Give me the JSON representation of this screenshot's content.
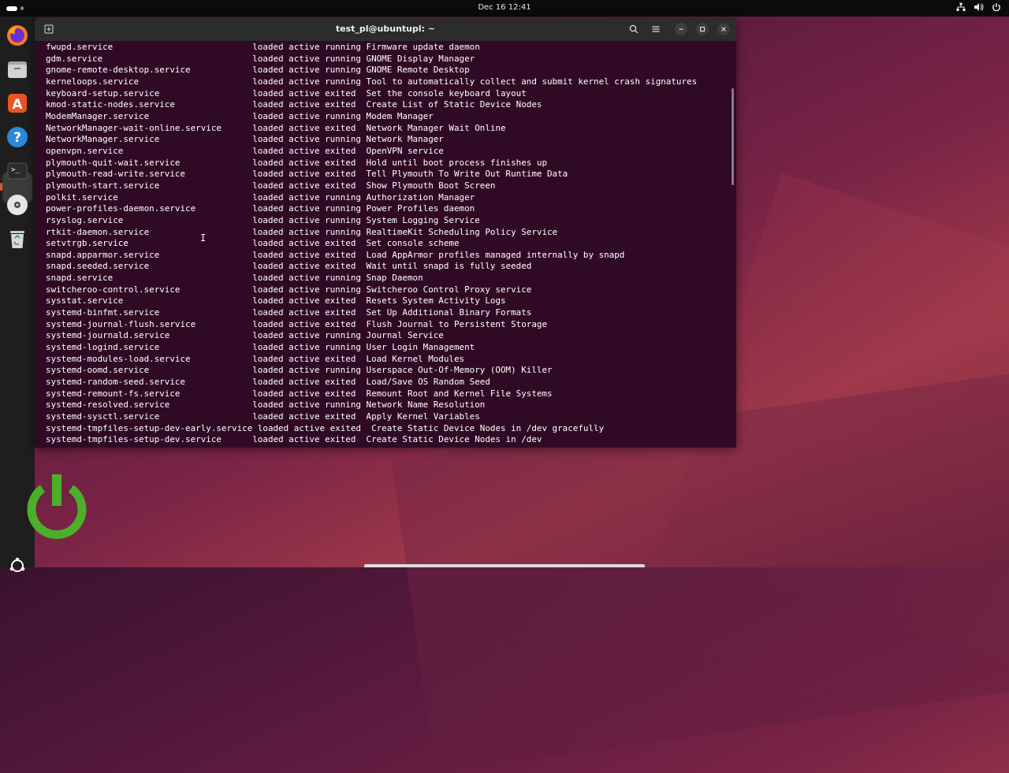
{
  "topbar": {
    "clock": "Dec 16  12:41",
    "tray_icons": [
      "network-icon",
      "volume-icon",
      "power-icon"
    ]
  },
  "dock": {
    "items": [
      "Firefox",
      "Files",
      "App Center",
      "Help",
      "Terminal",
      "Disc",
      "Trash"
    ],
    "active": "Terminal",
    "accent": "#e95420"
  },
  "terminal": {
    "title": "test_pl@ubuntupl: ~",
    "background": "#300a24",
    "lines": [
      "fwupd.service                           loaded active running Firmware update daemon",
      "gdm.service                             loaded active running GNOME Display Manager",
      "gnome-remote-desktop.service            loaded active running GNOME Remote Desktop",
      "kerneloops.service                      loaded active running Tool to automatically collect and submit kernel crash signatures",
      "keyboard-setup.service                  loaded active exited  Set the console keyboard layout",
      "kmod-static-nodes.service               loaded active exited  Create List of Static Device Nodes",
      "ModemManager.service                    loaded active running Modem Manager",
      "NetworkManager-wait-online.service      loaded active exited  Network Manager Wait Online",
      "NetworkManager.service                  loaded active running Network Manager",
      "openvpn.service                         loaded active exited  OpenVPN service",
      "plymouth-quit-wait.service              loaded active exited  Hold until boot process finishes up",
      "plymouth-read-write.service             loaded active exited  Tell Plymouth To Write Out Runtime Data",
      "plymouth-start.service                  loaded active exited  Show Plymouth Boot Screen",
      "polkit.service                          loaded active running Authorization Manager",
      "power-profiles-daemon.service           loaded active running Power Profiles daemon",
      "rsyslog.service                         loaded active running System Logging Service",
      "rtkit-daemon.service                    loaded active running RealtimeKit Scheduling Policy Service",
      "setvtrgb.service                        loaded active exited  Set console scheme",
      "snapd.apparmor.service                  loaded active exited  Load AppArmor profiles managed internally by snapd",
      "snapd.seeded.service                    loaded active exited  Wait until snapd is fully seeded",
      "snapd.service                           loaded active running Snap Daemon",
      "switcheroo-control.service              loaded active running Switcheroo Control Proxy service",
      "sysstat.service                         loaded active exited  Resets System Activity Logs",
      "systemd-binfmt.service                  loaded active exited  Set Up Additional Binary Formats",
      "systemd-journal-flush.service           loaded active exited  Flush Journal to Persistent Storage",
      "systemd-journald.service                loaded active running Journal Service",
      "systemd-logind.service                  loaded active running User Login Management",
      "systemd-modules-load.service            loaded active exited  Load Kernel Modules",
      "systemd-oomd.service                    loaded active running Userspace Out-Of-Memory (OOM) Killer",
      "systemd-random-seed.service             loaded active exited  Load/Save OS Random Seed",
      "systemd-remount-fs.service              loaded active exited  Remount Root and Kernel File Systems",
      "systemd-resolved.service                loaded active running Network Name Resolution",
      "systemd-sysctl.service                  loaded active exited  Apply Kernel Variables",
      "systemd-tmpfiles-setup-dev-early.service loaded active exited  Create Static Device Nodes in /dev gracefully",
      "systemd-tmpfiles-setup-dev.service      loaded active exited  Create Static Device Nodes in /dev"
    ]
  }
}
